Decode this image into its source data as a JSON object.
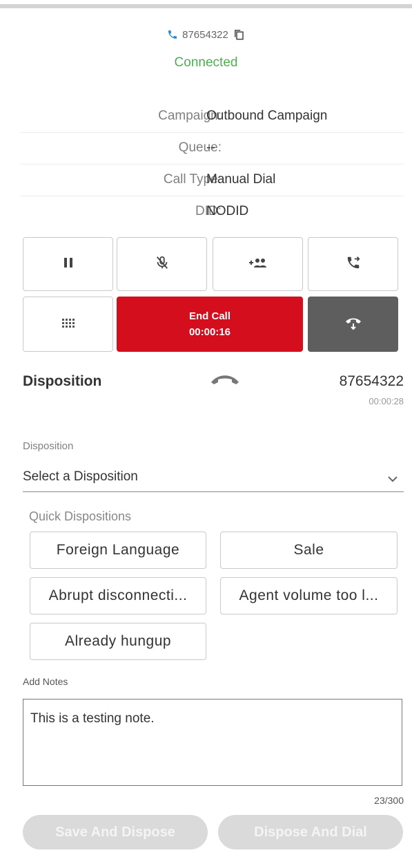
{
  "call": {
    "phone_number": "87654322",
    "status": "Connected",
    "status_color": "#4caf50"
  },
  "info": [
    {
      "label": "Campaign:",
      "value": "Outbound Campaign"
    },
    {
      "label": "Queue:",
      "value": "--"
    },
    {
      "label": "Call Type:",
      "value": "Manual Dial"
    },
    {
      "label": "DID:",
      "value": "NODID"
    }
  ],
  "controls": {
    "icons": [
      "pause-icon",
      "mute-mic-icon",
      "add-participant-icon",
      "transfer-call-icon",
      "dialpad-icon",
      "hangup-icon"
    ],
    "end_call_label": "End Call",
    "end_call_timer": "00:00:16",
    "end_call_color": "#d40e1d",
    "hangup_color": "#5e5e5e"
  },
  "disposition": {
    "title": "Disposition",
    "number": "87654322",
    "timer": "00:00:28",
    "field_label": "Disposition",
    "select_value": "Select a Disposition",
    "quick_label": "Quick Dispositions",
    "quick": [
      "Foreign Language",
      "Sale",
      "Abrupt disconnecti...",
      "Agent volume too l...",
      "Already hungup"
    ]
  },
  "notes": {
    "label": "Add Notes",
    "value": "This is a testing note.",
    "counter": "23/300"
  },
  "actions": {
    "save_label": "Save And Dispose",
    "dial_label": "Dispose And Dial"
  }
}
